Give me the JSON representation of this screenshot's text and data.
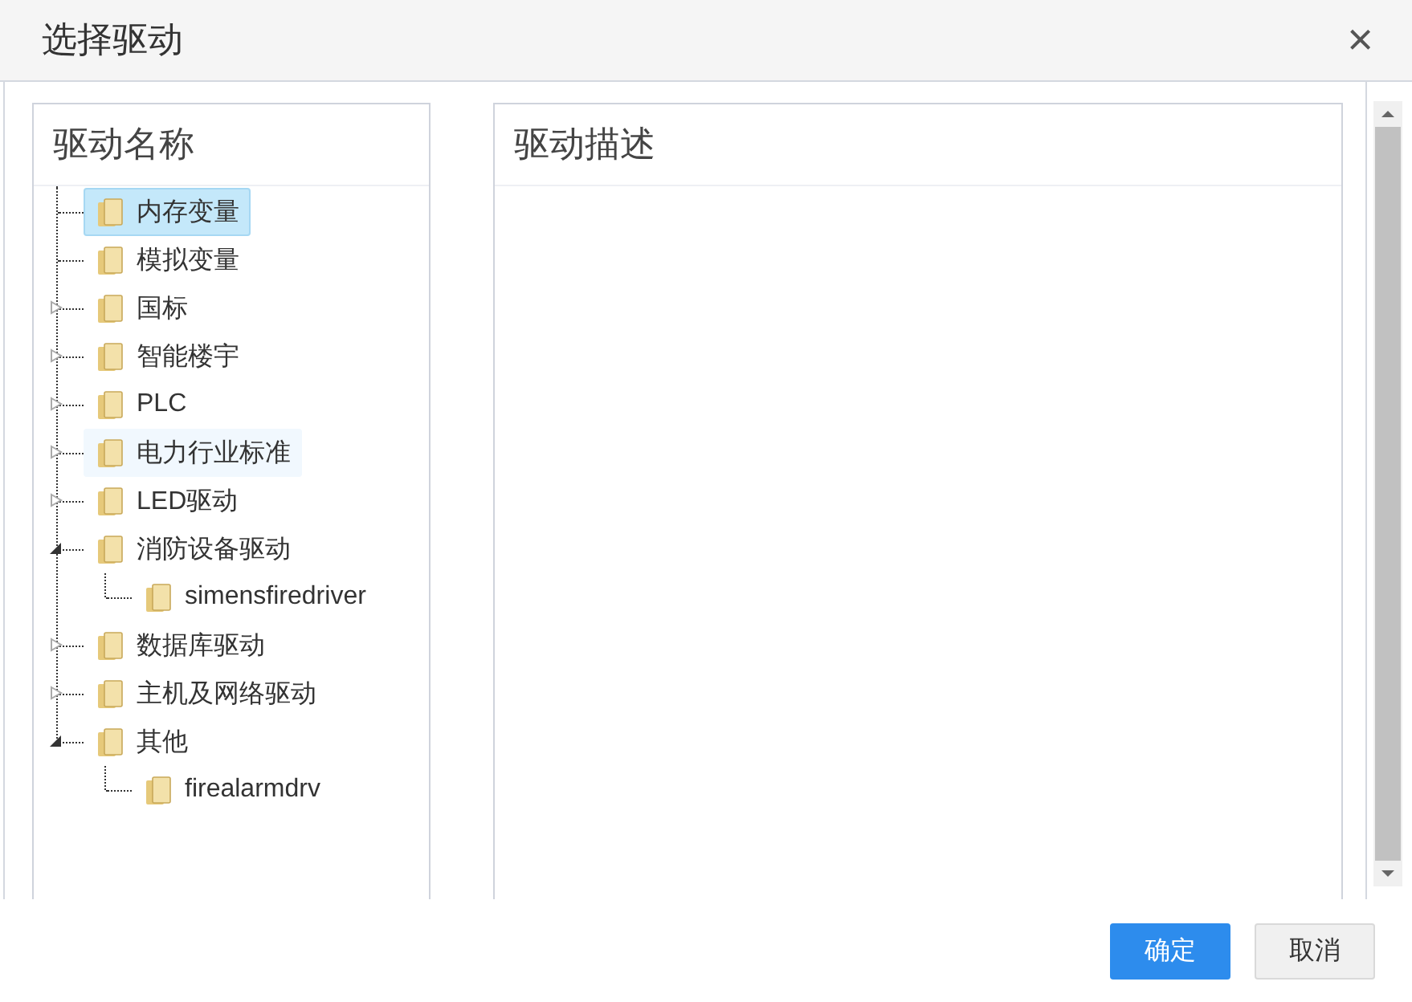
{
  "dialog": {
    "title": "选择驱动",
    "close": "×"
  },
  "tree_panel": {
    "title": "驱动名称",
    "items": [
      {
        "label": "内存变量",
        "kind": "leaf",
        "selected": true,
        "hovered": false
      },
      {
        "label": "模拟变量",
        "kind": "leaf",
        "selected": false,
        "hovered": false
      },
      {
        "label": "国标",
        "kind": "group",
        "expanded": false,
        "selected": false,
        "hovered": false
      },
      {
        "label": "智能楼宇",
        "kind": "group",
        "expanded": false,
        "selected": false,
        "hovered": false
      },
      {
        "label": "PLC",
        "kind": "group",
        "expanded": false,
        "selected": false,
        "hovered": false
      },
      {
        "label": "电力行业标准",
        "kind": "group",
        "expanded": false,
        "selected": false,
        "hovered": true
      },
      {
        "label": "LED驱动",
        "kind": "group",
        "expanded": false,
        "selected": false,
        "hovered": false
      },
      {
        "label": "消防设备驱动",
        "kind": "group",
        "expanded": true,
        "selected": false,
        "hovered": false,
        "children": [
          {
            "label": "simensfiredriver",
            "selected": false,
            "hovered": false
          }
        ]
      },
      {
        "label": "数据库驱动",
        "kind": "group",
        "expanded": false,
        "selected": false,
        "hovered": false
      },
      {
        "label": "主机及网络驱动",
        "kind": "group",
        "expanded": false,
        "selected": false,
        "hovered": false
      },
      {
        "label": "其他",
        "kind": "group",
        "expanded": true,
        "selected": false,
        "hovered": false,
        "children": [
          {
            "label": "firealarmdrv",
            "selected": false,
            "hovered": false
          }
        ]
      }
    ]
  },
  "description_panel": {
    "title": "驱动描述"
  },
  "buttons": [
    {
      "label": "确定",
      "kind": "primary"
    },
    {
      "label": "取消",
      "kind": "default"
    }
  ]
}
